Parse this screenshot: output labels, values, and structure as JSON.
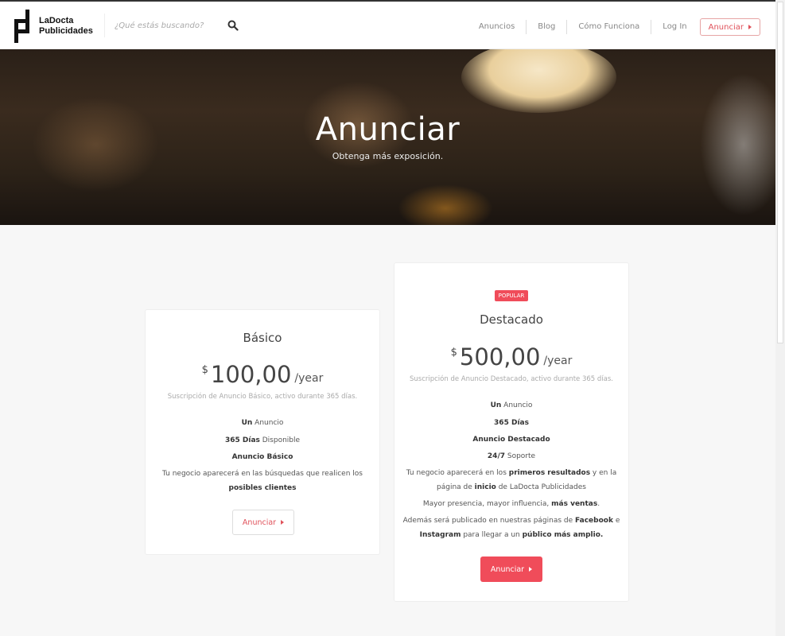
{
  "brand": {
    "line1": "LaDocta",
    "line2": "Publicidades"
  },
  "search": {
    "placeholder": "¿Qué estás buscando?"
  },
  "nav": {
    "items": [
      "Anuncios",
      "Blog",
      "Cómo Funciona",
      "Log In"
    ],
    "cta": "Anunciar"
  },
  "hero": {
    "title": "Anunciar",
    "subtitle": "Obtenga más exposición."
  },
  "plans": {
    "basic": {
      "name": "Básico",
      "currency": "$",
      "amount": "100,00",
      "period": "/year",
      "description": "Suscripción de Anuncio Básico, activo durante 365 días.",
      "f1_bold": "Un",
      "f1_rest": " Anuncio",
      "f2_bold": "365 Días",
      "f2_rest": " Disponible",
      "f3_bold": "Anuncio Básico",
      "f4_a": "Tu negocio aparecerá en las búsquedas que realicen los",
      "f4_bold": "posibles clientes",
      "button": "Anunciar"
    },
    "featured": {
      "badge": "POPULAR",
      "name": "Destacado",
      "currency": "$",
      "amount": "500,00",
      "period": "/year",
      "description": "Suscripción de Anuncio Destacado, activo durante 365 días.",
      "f1_bold": "Un",
      "f1_rest": " Anuncio",
      "f2_bold": "365 Días",
      "f3_bold": "Anuncio Destacado",
      "f4_bold": "24/7",
      "f4_rest": " Soporte",
      "f5_a": "Tu negocio aparecerá en los ",
      "f5_bold": "primeros resultados",
      "f5_b": " y en la",
      "f5_c": "página de ",
      "f5_bold2": "inicio",
      "f5_d": " de LaDocta Publicidades",
      "f6_a": "Mayor presencia, mayor influencia, ",
      "f6_bold": "más ventas",
      "f6_b": ".",
      "f7_a": "Además será publicado en nuestras páginas de ",
      "f7_bold": "Facebook",
      "f7_b": " e",
      "f7_bold2": "Instagram",
      "f7_c": " para llegar a un ",
      "f7_bold3": "público más amplio.",
      "button": "Anunciar"
    }
  },
  "colors": {
    "accent": "#f04c5a",
    "text": "#333333",
    "muted": "#aaaaaa",
    "background": "#f7f7f7"
  },
  "icons": {
    "search": "search-icon",
    "caret": "caret-right-icon",
    "logo": "logo-mark"
  }
}
